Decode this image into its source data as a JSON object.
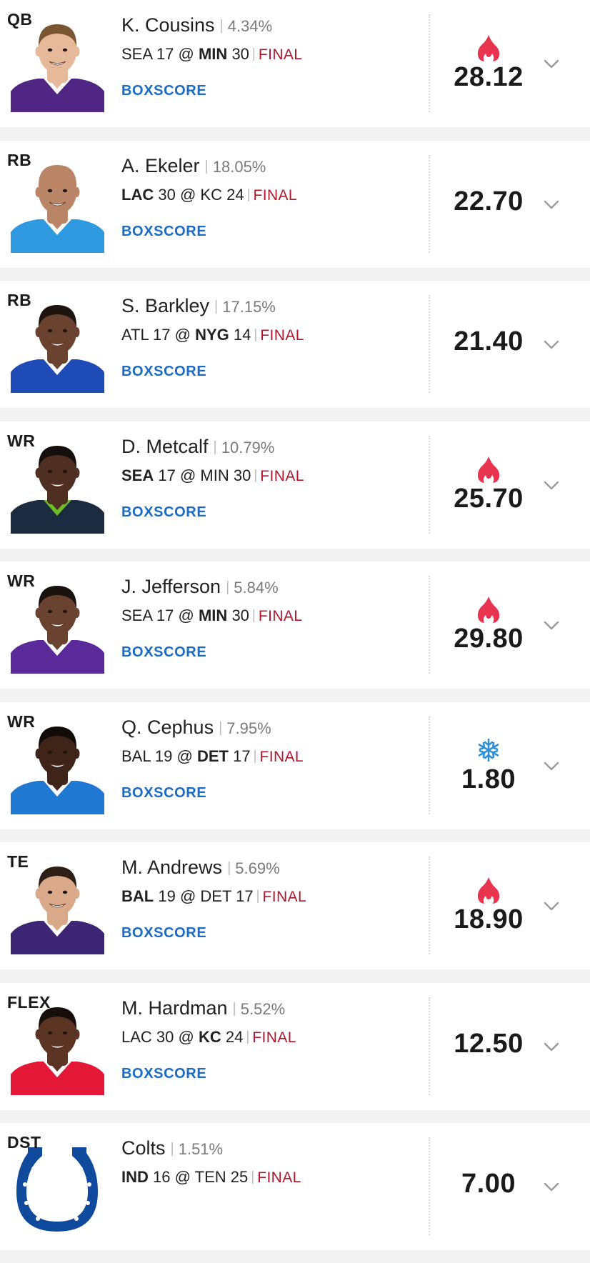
{
  "roster": [
    {
      "pos": "QB",
      "name": "K. Cousins",
      "pct": "4.34%",
      "game": {
        "away": "SEA",
        "away_score": "17",
        "home": "MIN",
        "home_score": "30",
        "winner": "home",
        "status": "FINAL"
      },
      "boxscore": "BOXSCORE",
      "points": "28.12",
      "trend": "hot",
      "headshot": {
        "skin": "#e6b99a",
        "hair": "#7a5532",
        "jersey": "#4f2683",
        "collar": "#ffffff",
        "bg": "#ffffff"
      }
    },
    {
      "pos": "RB",
      "name": "A. Ekeler",
      "pct": "18.05%",
      "game": {
        "away": "LAC",
        "away_score": "30",
        "home": "KC",
        "home_score": "24",
        "winner": "away",
        "status": "FINAL"
      },
      "boxscore": "BOXSCORE",
      "points": "22.70",
      "trend": "none",
      "headshot": {
        "skin": "#b98566",
        "hair": "#b98566",
        "jersey": "#2f9ae0",
        "collar": "#ffffff",
        "bg": "#ffffff"
      }
    },
    {
      "pos": "RB",
      "name": "S. Barkley",
      "pct": "17.15%",
      "game": {
        "away": "ATL",
        "away_score": "17",
        "home": "NYG",
        "home_score": "14",
        "winner": "home",
        "status": "FINAL"
      },
      "boxscore": "BOXSCORE",
      "points": "21.40",
      "trend": "none",
      "headshot": {
        "skin": "#6b4230",
        "hair": "#1d1410",
        "jersey": "#1f4bb7",
        "collar": "#ffffff",
        "bg": "#ffffff"
      }
    },
    {
      "pos": "WR",
      "name": "D. Metcalf",
      "pct": "10.79%",
      "game": {
        "away": "SEA",
        "away_score": "17",
        "home": "MIN",
        "home_score": "30",
        "winner": "away",
        "status": "FINAL"
      },
      "boxscore": "BOXSCORE",
      "points": "25.70",
      "trend": "hot",
      "headshot": {
        "skin": "#4e2f22",
        "hair": "#15100d",
        "jersey": "#1c2b3f",
        "collar": "#69be28",
        "bg": "#ffffff"
      }
    },
    {
      "pos": "WR",
      "name": "J. Jefferson",
      "pct": "5.84%",
      "game": {
        "away": "SEA",
        "away_score": "17",
        "home": "MIN",
        "home_score": "30",
        "winner": "home",
        "status": "FINAL"
      },
      "boxscore": "BOXSCORE",
      "points": "29.80",
      "trend": "hot",
      "headshot": {
        "skin": "#6a4230",
        "hair": "#1a120e",
        "jersey": "#5a2a9a",
        "collar": "#ffffff",
        "bg": "#ffffff"
      }
    },
    {
      "pos": "WR",
      "name": "Q. Cephus",
      "pct": "7.95%",
      "game": {
        "away": "BAL",
        "away_score": "19",
        "home": "DET",
        "home_score": "17",
        "winner": "home",
        "status": "FINAL"
      },
      "boxscore": "BOXSCORE",
      "points": "1.80",
      "trend": "cold",
      "headshot": {
        "skin": "#3e2419",
        "hair": "#120c09",
        "jersey": "#1f78d1",
        "collar": "#ffffff",
        "bg": "#ffffff"
      }
    },
    {
      "pos": "TE",
      "name": "M. Andrews",
      "pct": "5.69%",
      "game": {
        "away": "BAL",
        "away_score": "19",
        "home": "DET",
        "home_score": "17",
        "winner": "away",
        "status": "FINAL"
      },
      "boxscore": "BOXSCORE",
      "points": "18.90",
      "trend": "hot",
      "headshot": {
        "skin": "#d9a98a",
        "hair": "#2e1f16",
        "jersey": "#3d2576",
        "collar": "#ffffff",
        "bg": "#ffffff"
      }
    },
    {
      "pos": "FLEX",
      "name": "M. Hardman",
      "pct": "5.52%",
      "game": {
        "away": "LAC",
        "away_score": "30",
        "home": "KC",
        "home_score": "24",
        "winner": "home",
        "status": "FINAL"
      },
      "boxscore": "BOXSCORE",
      "points": "12.50",
      "trend": "none",
      "headshot": {
        "skin": "#5b3424",
        "hair": "#150e0b",
        "jersey": "#e31837",
        "collar": "#ffffff",
        "bg": "#ffffff"
      }
    },
    {
      "pos": "DST",
      "name": "Colts",
      "pct": "1.51%",
      "game": {
        "away": "IND",
        "away_score": "16",
        "home": "TEN",
        "home_score": "25",
        "winner": "away",
        "status": "FINAL"
      },
      "boxscore": "",
      "points": "7.00",
      "trend": "none",
      "logo": "horseshoe",
      "logo_color": "#0f4a9c"
    }
  ],
  "colors": {
    "hot": "#e8344e",
    "cold": "#2b8fd8",
    "final": "#b0172b",
    "link": "#1a6bc4"
  },
  "icons": {
    "hot": "flame-icon",
    "cold": "snowflake-icon",
    "expand": "chevron-down-icon"
  }
}
